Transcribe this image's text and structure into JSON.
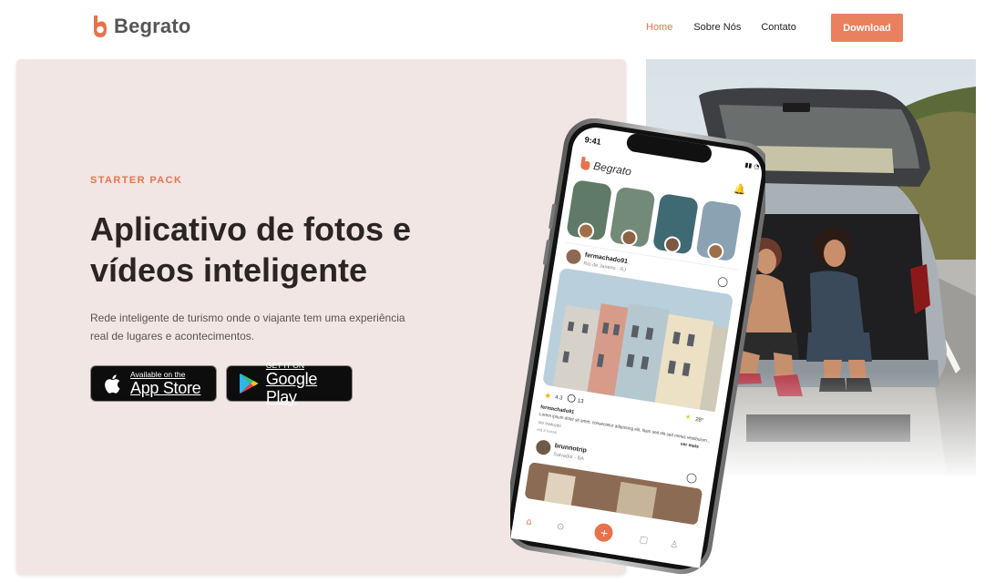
{
  "header": {
    "brand": "Begrato",
    "nav": {
      "home": "Home",
      "about": "Sobre Nós",
      "contact": "Contato"
    },
    "download_label": "Download"
  },
  "hero": {
    "eyebrow": "STARTER PACK",
    "title_line1": "Aplicativo de fotos e",
    "title_line2": "vídeos inteligente",
    "description_line1": "Rede inteligente de turismo onde o viajante tem uma experiência",
    "description_line2": "real de lugares e acontecimentos."
  },
  "stores": {
    "apple": {
      "small": "Available on the",
      "big": "App Store"
    },
    "google": {
      "small": "GET IT ON",
      "big": "Google Play"
    }
  },
  "phone": {
    "time": "9:41",
    "app_name": "Begrato",
    "post1": {
      "user": "fermachado91",
      "location": "Rio de Janeiro - RJ",
      "rating": "4.3",
      "comments": "13",
      "temperature": "28°",
      "caption_user": "fermachado91",
      "caption": "Lorem ipsum dolor sit amet, consectetur adipiscing elit. Nam sed elit sed metus vestibulum...",
      "more": "ver mais",
      "translate": "Ver tradução",
      "time_ago": "Há 3 horas"
    },
    "post2": {
      "user": "brunnotrip",
      "location": "Salvador - BA"
    }
  },
  "colors": {
    "accent": "#e9724c",
    "button": "#e9815f",
    "hero_bg": "#f1e6e3",
    "title": "#2b2424"
  }
}
